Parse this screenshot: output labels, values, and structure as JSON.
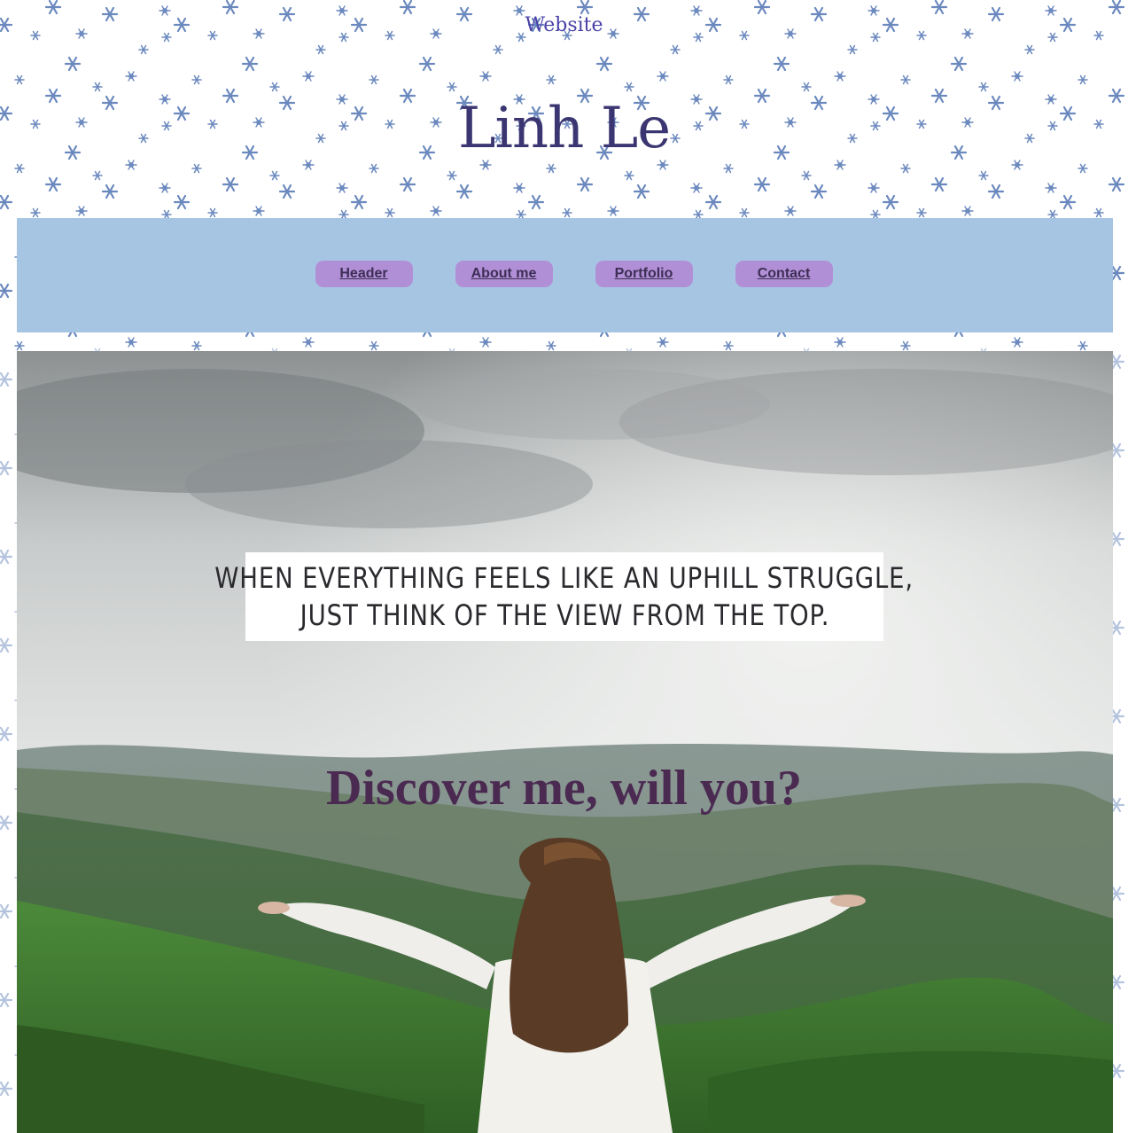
{
  "site": {
    "top_label": "Website",
    "title": "Linh Le"
  },
  "nav": {
    "items": [
      {
        "label": "Header"
      },
      {
        "label": "About me"
      },
      {
        "label": "Portfolio"
      },
      {
        "label": "Contact"
      }
    ]
  },
  "hero": {
    "quote_line_1": "WHEN EVERYTHING FEELS LIKE AN UPHILL STRUGGLE,",
    "quote_line_2": "JUST THINK OF THE VIEW FROM THE TOP.",
    "tagline": "Discover me, will you?"
  },
  "colors": {
    "nav_bar": "#a6c5e3",
    "nav_button": "#b18fd6",
    "title": "#3b3672",
    "tagline": "#4b2a52",
    "snowflake": "#5b7db8"
  },
  "icons": {
    "background_pattern": "snowflake-icon"
  }
}
